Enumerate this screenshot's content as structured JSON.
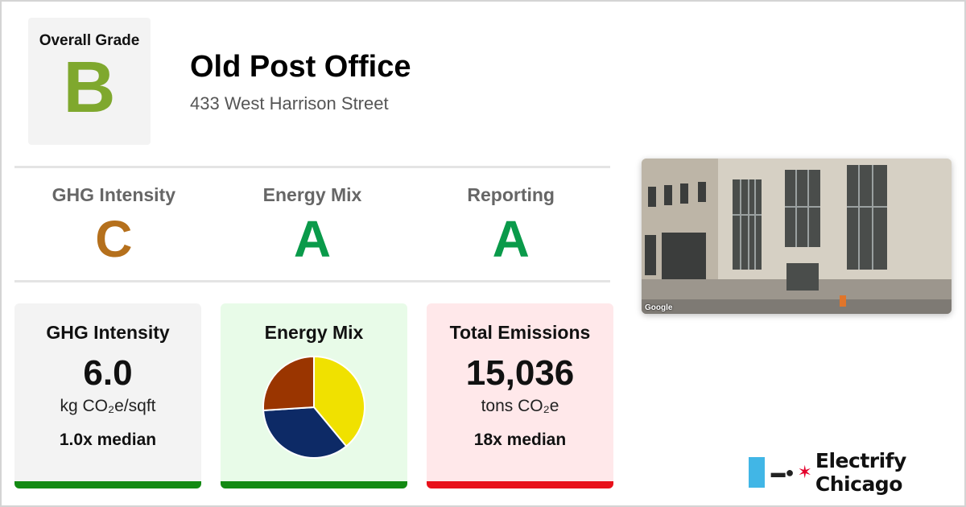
{
  "overall": {
    "label": "Overall Grade",
    "grade": "B",
    "color": "#7fa82e"
  },
  "building": {
    "name": "Old Post Office",
    "address": "433 West Harrison Street"
  },
  "subgrades": [
    {
      "label": "GHG Intensity",
      "grade": "C",
      "color": "#b5701c"
    },
    {
      "label": "Energy Mix",
      "grade": "A",
      "color": "#0a9a4a"
    },
    {
      "label": "Reporting",
      "grade": "A",
      "color": "#0a9a4a"
    }
  ],
  "cards": {
    "ghg": {
      "title": "GHG Intensity",
      "value": "6.0",
      "unit": "kg CO₂e/sqft",
      "median": "1.0x median",
      "bg": "#f3f3f3",
      "bar": "#138a13"
    },
    "mix": {
      "title": "Energy Mix",
      "bg": "#e8fbe8",
      "bar": "#138a13"
    },
    "emissions": {
      "title": "Total Emissions",
      "value": "15,036",
      "unit": "tons CO₂e",
      "median": "18x median",
      "bg": "#ffe8ea",
      "bar": "#e8101a"
    }
  },
  "chart_data": {
    "type": "pie",
    "title": "",
    "slices": [
      {
        "value": 0.39,
        "color": "#f0e100"
      },
      {
        "value": 0.35,
        "color": "#0d2a66"
      },
      {
        "value": 0.26,
        "color": "#9a3500"
      }
    ]
  },
  "photo": {
    "credit": "Google",
    "icon": "street-view-photo"
  },
  "logo": {
    "text": "Electrify Chicago",
    "icons": [
      "plug-icon",
      "star-icon"
    ],
    "flag_color": "#41b6e6",
    "star_color": "#e4002b"
  }
}
